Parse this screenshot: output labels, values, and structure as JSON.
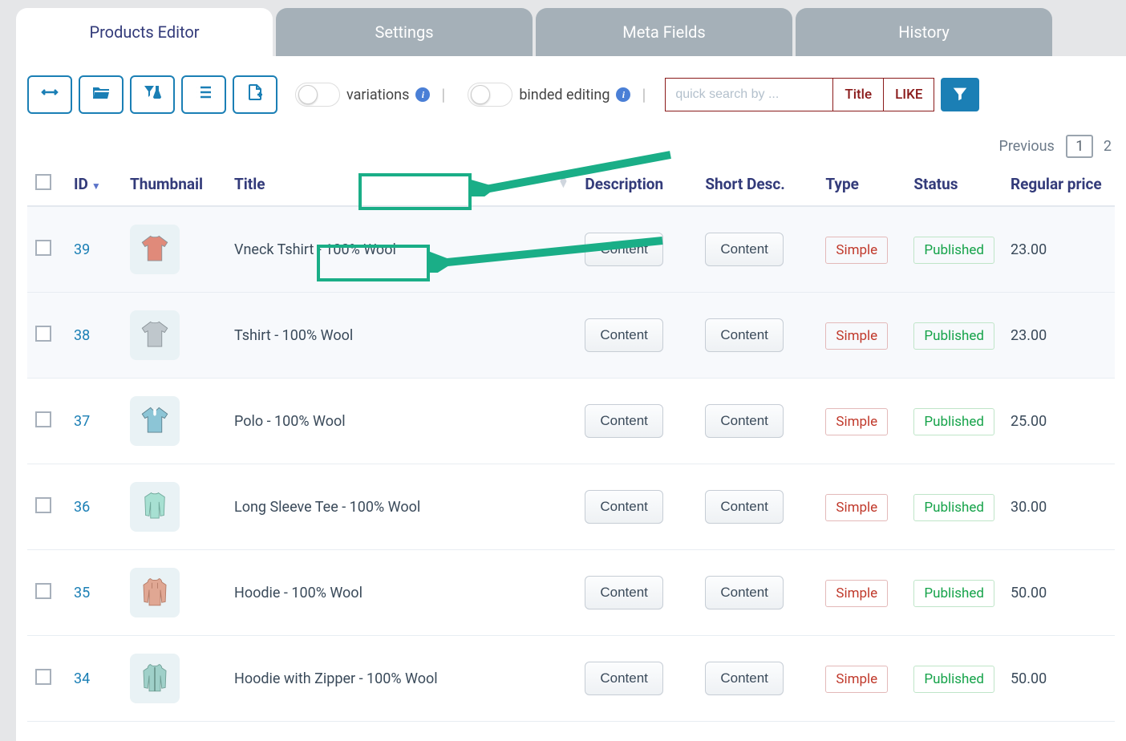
{
  "tabs": {
    "products": "Products Editor",
    "settings": "Settings",
    "meta": "Meta Fields",
    "history": "History"
  },
  "toolbar": {
    "variations_label": "variations",
    "binded_label": "binded editing",
    "search_placeholder": "quick search by ...",
    "search_field": "Title",
    "search_op": "LIKE"
  },
  "pager": {
    "previous": "Previous",
    "page1": "1",
    "page2": "2"
  },
  "columns": {
    "id": "ID",
    "thumbnail": "Thumbnail",
    "title": "Title",
    "description": "Description",
    "short_desc": "Short Desc.",
    "type": "Type",
    "status": "Status",
    "regular_price": "Regular price"
  },
  "buttons": {
    "content": "Content"
  },
  "tags": {
    "simple": "Simple",
    "published": "Published"
  },
  "rows": [
    {
      "id": "39",
      "title": "Vneck Tshirt - 100% Wool",
      "price": "23.00",
      "thumb_color": "#e08a7a",
      "thumb_kind": "tshirt"
    },
    {
      "id": "38",
      "title": "Tshirt - 100% Wool",
      "price": "23.00",
      "thumb_color": "#bfc7cc",
      "thumb_kind": "tshirt"
    },
    {
      "id": "37",
      "title": "Polo - 100% Wool",
      "price": "25.00",
      "thumb_color": "#8cc5d6",
      "thumb_kind": "polo"
    },
    {
      "id": "36",
      "title": "Long Sleeve Tee - 100% Wool",
      "price": "30.00",
      "thumb_color": "#a7e0d2",
      "thumb_kind": "longsleeve"
    },
    {
      "id": "35",
      "title": "Hoodie - 100% Wool",
      "price": "50.00",
      "thumb_color": "#e0a793",
      "thumb_kind": "hoodie"
    },
    {
      "id": "34",
      "title": "Hoodie with Zipper - 100% Wool",
      "price": "50.00",
      "thumb_color": "#9fd0c9",
      "thumb_kind": "hoodiezip"
    }
  ]
}
